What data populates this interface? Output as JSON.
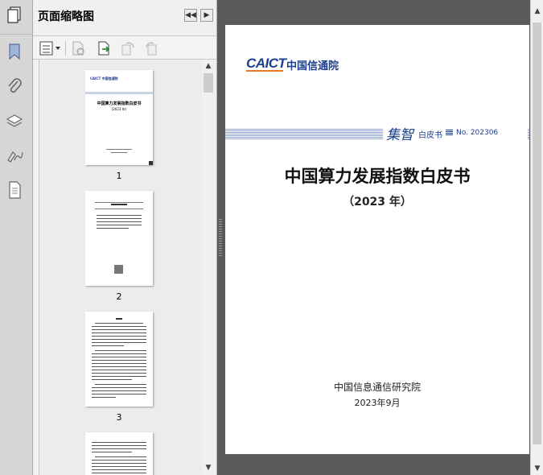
{
  "panel": {
    "title": "页面缩略图"
  },
  "thumbnails": [
    {
      "page_label": "1"
    },
    {
      "page_label": "2"
    },
    {
      "page_label": "3"
    }
  ],
  "document": {
    "logo_text": "CAICT",
    "logo_org": "中国信通院",
    "series_mark": "集智",
    "series_label": "白皮书",
    "series_number": "No. 202306",
    "title": "中国算力发展指数白皮书",
    "subtitle": "（2023 年）",
    "publisher": "中国信息通信研究院",
    "date": "2023年9月"
  },
  "colors": {
    "logo_blue": "#1d3f8f",
    "logo_orange": "#e87722",
    "band_blue": "#7a96c4"
  }
}
